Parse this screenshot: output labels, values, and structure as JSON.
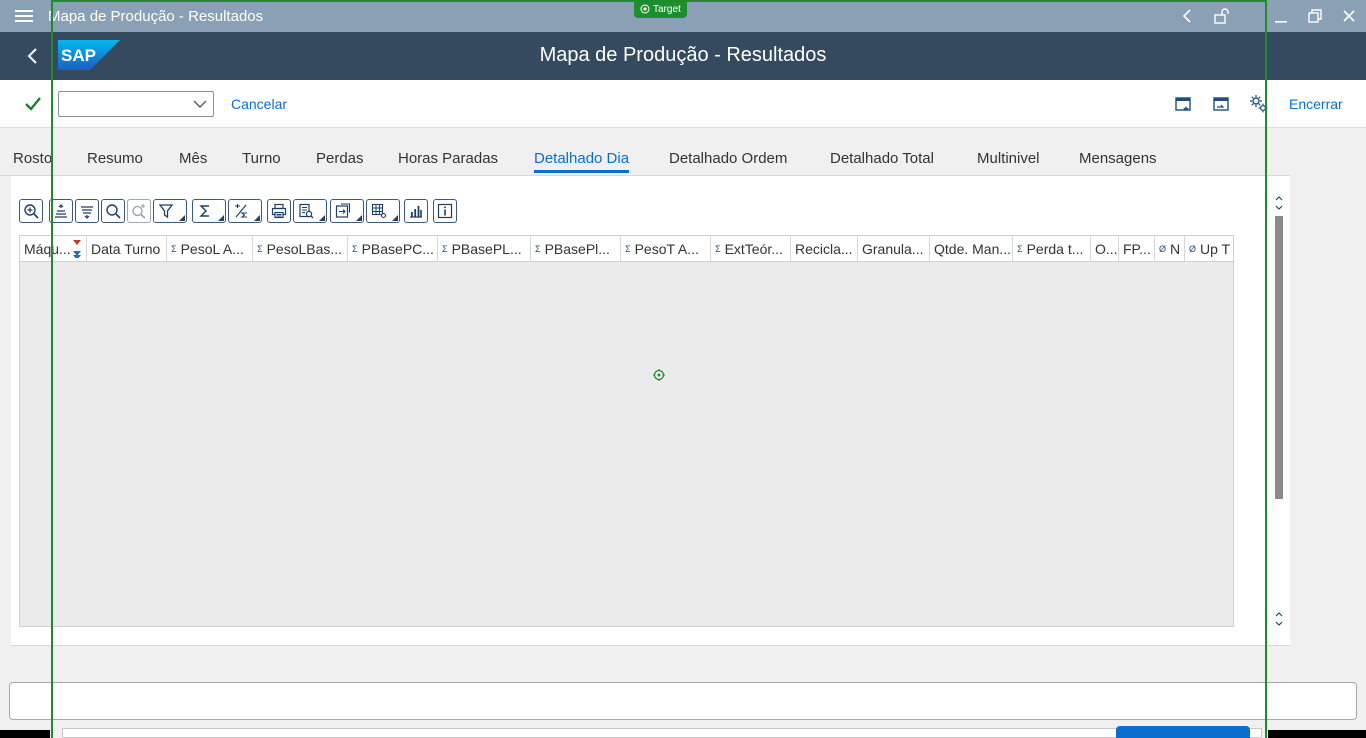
{
  "window": {
    "title": "Mapa de Produção - Resultados",
    "target_badge": "Target"
  },
  "shell": {
    "app_title": "Mapa de Produção - Resultados",
    "logo_text": "SAP"
  },
  "toolbar": {
    "okcode_value": "",
    "cancel_label": "Cancelar",
    "exit_label": "Encerrar"
  },
  "tabs": [
    {
      "label": "Rosto"
    },
    {
      "label": "Resumo"
    },
    {
      "label": "Mês"
    },
    {
      "label": "Turno"
    },
    {
      "label": "Perdas"
    },
    {
      "label": "Horas Paradas"
    },
    {
      "label": "Detalhado Dia"
    },
    {
      "label": "Detalhado Ordem"
    },
    {
      "label": "Detalhado Total"
    },
    {
      "label": "Multinivel"
    },
    {
      "label": "Mensagens"
    }
  ],
  "active_tab": "Detalhado Dia",
  "grid": {
    "columns": [
      {
        "label": "Máqu...",
        "sigma": ""
      },
      {
        "label": "Data Turno",
        "sigma": ""
      },
      {
        "label": "PesoL A...",
        "sigma": "Σ"
      },
      {
        "label": "PesoLBas...",
        "sigma": "Σ"
      },
      {
        "label": "PBasePC...",
        "sigma": "Σ"
      },
      {
        "label": "PBasePL...",
        "sigma": "Σ"
      },
      {
        "label": "PBasePl...",
        "sigma": "Σ"
      },
      {
        "label": "PesoT A...",
        "sigma": "Σ"
      },
      {
        "label": "ExtTeór...",
        "sigma": "Σ"
      },
      {
        "label": "Recicla...",
        "sigma": ""
      },
      {
        "label": "Granula...",
        "sigma": ""
      },
      {
        "label": "Qtde. Man...",
        "sigma": ""
      },
      {
        "label": "Perda t...",
        "sigma": "Σ"
      },
      {
        "label": "O...",
        "sigma": ""
      },
      {
        "label": "FP...",
        "sigma": ""
      },
      {
        "label": "N",
        "sigma": "Ø"
      },
      {
        "label": "Up T",
        "sigma": "Ø"
      }
    ],
    "rows": []
  },
  "colors": {
    "titlebar": "#8aa0b4",
    "shellbar": "#354a5f",
    "accent": "#0a6ed1",
    "confirm": "#1a7f2e",
    "frame": "#1f8a2e"
  },
  "icons": {
    "toolbar_right": [
      "new-window-icon",
      "restore-window-icon",
      "settings-icon"
    ],
    "alv": [
      "zoom-details-icon",
      "sort-ascending-icon",
      "sort-descending-icon",
      "find-icon",
      "find-next-icon",
      "filter-icon",
      "sum-icon",
      "subtotal-icon",
      "print-icon",
      "view-icon",
      "export-icon",
      "layout-icon",
      "graphic-icon",
      "info-icon"
    ]
  }
}
